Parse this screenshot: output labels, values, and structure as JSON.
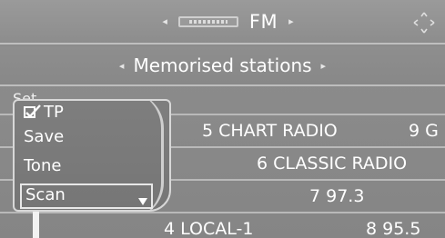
{
  "header": {
    "band": "FM",
    "left_arrow": "◂",
    "right_arrow": "▸",
    "radio_icon": "radio-display-icon",
    "nav_icon": "navigation-diamond-icon"
  },
  "subheader": {
    "title": "Memorised stations",
    "left_arrow": "◂",
    "right_arrow": "▸"
  },
  "context_menu": {
    "fragment": "Set",
    "items": [
      {
        "label": "TP",
        "icon": "check-icon",
        "checked": true
      },
      {
        "label": "Save"
      },
      {
        "label": "Tone"
      },
      {
        "label": "Scan",
        "selected": true,
        "icon": "submenu-arrow-icon"
      }
    ]
  },
  "stations": [
    {
      "label": "5 CHART RADIO",
      "freq": "9 G"
    },
    {
      "label": "6 CLASSIC RADIO"
    },
    {
      "label": "7 97.3"
    },
    {
      "label": "4 LOCAL-1",
      "freq": "8 95.5"
    }
  ],
  "colors": {
    "background": "#8a8a8a",
    "text": "#ffffff",
    "border": "#d8d8d8"
  }
}
